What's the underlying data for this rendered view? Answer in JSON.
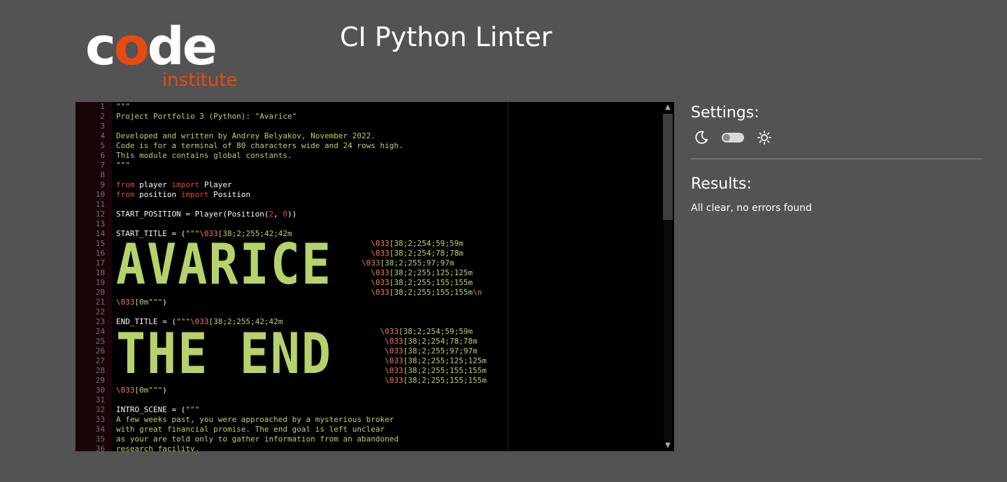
{
  "logo": {
    "word": "code",
    "sub": "institute"
  },
  "title": "CI Python Linter",
  "editor": {
    "lines": [
      {
        "n": "1",
        "parts": [
          {
            "c": "t-str",
            "t": "\"\"\""
          }
        ]
      },
      {
        "n": "2",
        "parts": [
          {
            "c": "t-str",
            "t": "Project Portfolio 3 (Python): \"Avarice\""
          }
        ]
      },
      {
        "n": "3",
        "parts": []
      },
      {
        "n": "4",
        "parts": [
          {
            "c": "t-str",
            "t": "Developed and written by Andrey Belyakov, November 2022."
          }
        ]
      },
      {
        "n": "5",
        "parts": [
          {
            "c": "t-str",
            "t": "Code is for a terminal of 80 characters wide and 24 rows high."
          }
        ]
      },
      {
        "n": "6",
        "parts": [
          {
            "c": "t-str",
            "t": "This module contains global constants."
          }
        ]
      },
      {
        "n": "7",
        "parts": [
          {
            "c": "t-str",
            "t": "\"\"\""
          }
        ]
      },
      {
        "n": "8",
        "parts": []
      },
      {
        "n": "9",
        "parts": [
          {
            "c": "t-kw",
            "t": "from"
          },
          {
            "c": "t-plain",
            "t": " player "
          },
          {
            "c": "t-kw",
            "t": "import"
          },
          {
            "c": "t-plain",
            "t": " Player"
          }
        ]
      },
      {
        "n": "10",
        "parts": [
          {
            "c": "t-kw",
            "t": "from"
          },
          {
            "c": "t-plain",
            "t": " position "
          },
          {
            "c": "t-kw",
            "t": "import"
          },
          {
            "c": "t-plain",
            "t": " Position"
          }
        ]
      },
      {
        "n": "11",
        "parts": []
      },
      {
        "n": "12",
        "parts": [
          {
            "c": "t-plain",
            "t": "START_POSITION = Player(Position("
          },
          {
            "c": "t-num",
            "t": "2"
          },
          {
            "c": "t-plain",
            "t": ", "
          },
          {
            "c": "t-num",
            "t": "0"
          },
          {
            "c": "t-plain",
            "t": "))"
          }
        ]
      },
      {
        "n": "13",
        "parts": []
      },
      {
        "n": "14",
        "parts": [
          {
            "c": "t-plain",
            "t": "START_TITLE = ("
          },
          {
            "c": "t-str",
            "t": "\"\"\""
          },
          {
            "c": "t-esc",
            "t": "\\033"
          },
          {
            "c": "t-str",
            "t": "[38;2;255;42;42m"
          }
        ]
      },
      {
        "n": "15",
        "parts": [
          {
            "c": "t-str",
            "t": "                                                       "
          },
          {
            "c": "t-esc",
            "t": "\\033"
          },
          {
            "c": "t-str",
            "t": "[38;2;254;59;59m"
          }
        ]
      },
      {
        "n": "16",
        "parts": [
          {
            "c": "t-str",
            "t": "                                                       "
          },
          {
            "c": "t-esc",
            "t": "\\033"
          },
          {
            "c": "t-str",
            "t": "[38;2;254;78;78m"
          }
        ]
      },
      {
        "n": "17",
        "parts": [
          {
            "c": "t-str",
            "t": "                                                     "
          },
          {
            "c": "t-esc",
            "t": "\\033"
          },
          {
            "c": "t-str",
            "t": "[38;2;255;97;97m"
          }
        ]
      },
      {
        "n": "18",
        "parts": [
          {
            "c": "t-str",
            "t": "                                                       "
          },
          {
            "c": "t-esc",
            "t": "\\033"
          },
          {
            "c": "t-str",
            "t": "[38;2;255;125;125m"
          }
        ]
      },
      {
        "n": "19",
        "parts": [
          {
            "c": "t-str",
            "t": "                                                       "
          },
          {
            "c": "t-esc",
            "t": "\\033"
          },
          {
            "c": "t-str",
            "t": "[38;2;255;155;155m"
          }
        ]
      },
      {
        "n": "20",
        "parts": [
          {
            "c": "t-str",
            "t": "                                                       "
          },
          {
            "c": "t-esc",
            "t": "\\033"
          },
          {
            "c": "t-str",
            "t": "[38;2;255;155;155m"
          },
          {
            "c": "t-esc",
            "t": "\\n"
          }
        ]
      },
      {
        "n": "21",
        "parts": [
          {
            "c": "t-esc",
            "t": "\\033"
          },
          {
            "c": "t-str",
            "t": "[0m\"\"\""
          },
          {
            "c": "t-plain",
            "t": ")"
          }
        ]
      },
      {
        "n": "22",
        "parts": []
      },
      {
        "n": "23",
        "parts": [
          {
            "c": "t-plain",
            "t": "END_TITLE = ("
          },
          {
            "c": "t-str",
            "t": "\"\"\""
          },
          {
            "c": "t-esc",
            "t": "\\033"
          },
          {
            "c": "t-str",
            "t": "[38;2;255;42;42m"
          }
        ]
      },
      {
        "n": "24",
        "parts": [
          {
            "c": "t-str",
            "t": "                                                         "
          },
          {
            "c": "t-esc",
            "t": "\\033"
          },
          {
            "c": "t-str",
            "t": "[38;2;254;59;59m"
          }
        ]
      },
      {
        "n": "25",
        "parts": [
          {
            "c": "t-str",
            "t": "                                                          "
          },
          {
            "c": "t-esc",
            "t": "\\033"
          },
          {
            "c": "t-str",
            "t": "[38;2;254;78;78m"
          }
        ]
      },
      {
        "n": "26",
        "parts": [
          {
            "c": "t-str",
            "t": "                                                          "
          },
          {
            "c": "t-esc",
            "t": "\\033"
          },
          {
            "c": "t-str",
            "t": "[38;2;255;97;97m"
          }
        ]
      },
      {
        "n": "27",
        "parts": [
          {
            "c": "t-str",
            "t": "                                                          "
          },
          {
            "c": "t-esc",
            "t": "\\033"
          },
          {
            "c": "t-str",
            "t": "[38;2;255;125;125m"
          }
        ]
      },
      {
        "n": "28",
        "parts": [
          {
            "c": "t-str",
            "t": "                                                          "
          },
          {
            "c": "t-esc",
            "t": "\\033"
          },
          {
            "c": "t-str",
            "t": "[38;2;255;155;155m"
          }
        ]
      },
      {
        "n": "29",
        "parts": [
          {
            "c": "t-str",
            "t": "                                                          "
          },
          {
            "c": "t-esc",
            "t": "\\033"
          },
          {
            "c": "t-str",
            "t": "[38;2;255;155;155m"
          }
        ]
      },
      {
        "n": "30",
        "parts": [
          {
            "c": "t-esc",
            "t": "\\033"
          },
          {
            "c": "t-str",
            "t": "[0m\"\"\""
          },
          {
            "c": "t-plain",
            "t": ")"
          }
        ]
      },
      {
        "n": "31",
        "parts": []
      },
      {
        "n": "32",
        "parts": [
          {
            "c": "t-plain",
            "t": "INTRO_SCENE = ("
          },
          {
            "c": "t-str",
            "t": "\"\"\""
          }
        ]
      },
      {
        "n": "33",
        "parts": [
          {
            "c": "t-str",
            "t": "A few weeks past, you were approached by a mysterious broker"
          }
        ]
      },
      {
        "n": "34",
        "parts": [
          {
            "c": "t-str",
            "t": "with great financial promise. The end goal is left unclear"
          }
        ]
      },
      {
        "n": "35",
        "parts": [
          {
            "c": "t-str",
            "t": "as your are told only to gather information from an abandoned"
          }
        ]
      },
      {
        "n": "36",
        "parts": [
          {
            "c": "t-str",
            "t": "research facility."
          }
        ]
      }
    ],
    "ascii_art": [
      "AVARICE",
      "THE END"
    ]
  },
  "settings": {
    "title": "Settings:",
    "theme": "dark"
  },
  "results": {
    "title": "Results:",
    "message": "All clear, no errors found"
  },
  "colors": {
    "background": "#535353",
    "accent": "#e84a0f",
    "string": "#b5d36a",
    "keyword": "#e8473e"
  },
  "icons": {
    "moon": "moon-icon",
    "sun": "sun-icon"
  }
}
